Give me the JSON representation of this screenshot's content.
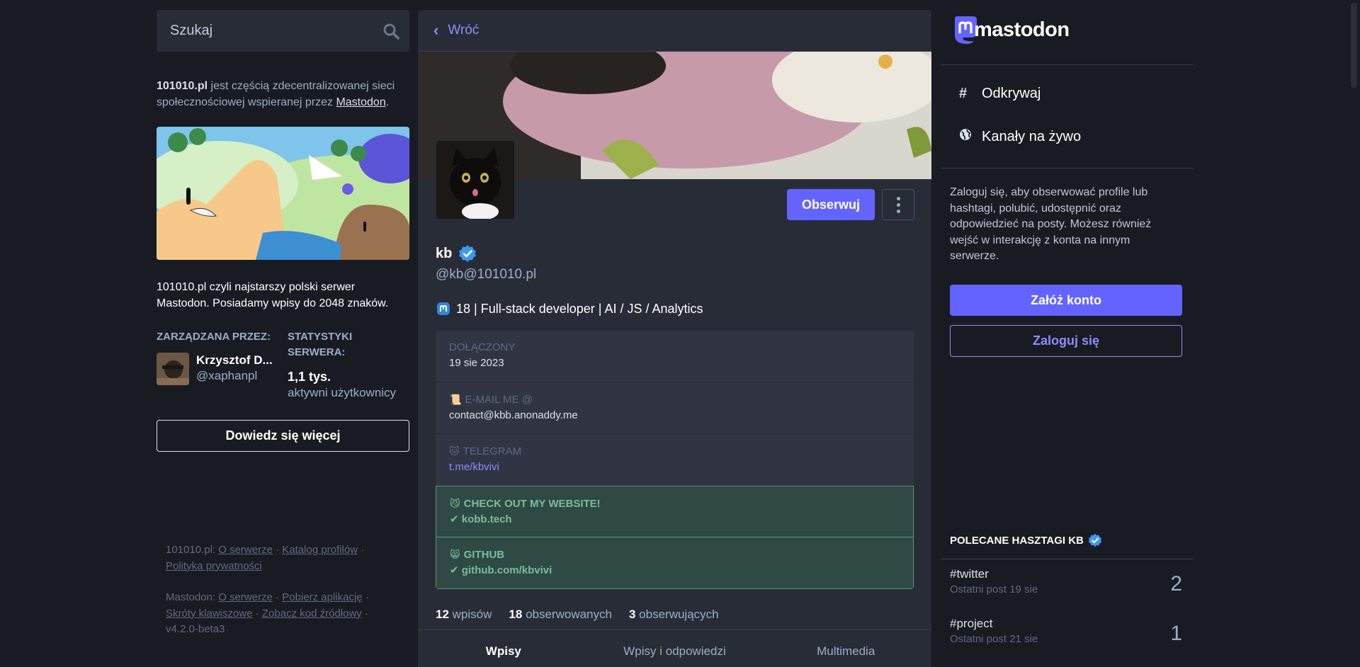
{
  "search": {
    "placeholder": "Szukaj"
  },
  "server_intro": {
    "domain": "101010.pl",
    "text": " jest częścią zdecentralizowanej sieci społecznościowej wspieranej przez ",
    "link": "Mastodon",
    "end": "."
  },
  "server_description": "101010.pl czyli najstarszy polski serwer Mastodon. Posiadamy wpisy do 2048 znaków.",
  "administered_by": {
    "label": "ZARZĄDZANA PRZEZ:",
    "name": "Krzysztof D...",
    "handle": "@xaphanpl"
  },
  "server_stats": {
    "label": "STATYSTYKI SERWERA:",
    "value": "1,1 tys.",
    "unit": "aktywni użytkownicy"
  },
  "learn_more_label": "Dowiedz się więcej",
  "footer": {
    "server_label": "101010.pl:",
    "server_links": [
      "O serwerze",
      "Katalog profilów",
      "Polityka prywatności"
    ],
    "mastodon_label": "Mastodon:",
    "mastodon_links": [
      "O serwerze",
      "Pobierz aplikację",
      "Skróty klawiszowe",
      "Zobacz kod źródłowy"
    ],
    "version": "v4.2.0-beta3",
    "sep": "·"
  },
  "back_label": "Wróć",
  "profile": {
    "display_name": "kb",
    "handle": "@kb@101010.pl",
    "bio": "18 | Full-stack developer | AI / JS / Analytics",
    "follow_label": "Obserwuj",
    "fields": [
      {
        "emoji": "",
        "label": "DOŁĄCZONY",
        "value": "19 sie 2023",
        "verified": false,
        "link": false
      },
      {
        "emoji": "📜",
        "label": "E-MAIL ME @",
        "value": "contact@kbb.anonaddy.me",
        "verified": false,
        "link": false
      },
      {
        "emoji": "🐱",
        "label": "TELEGRAM",
        "value": "t.me/kbvivi",
        "verified": false,
        "link": true
      },
      {
        "emoji": "😼",
        "label": "CHECK OUT MY WEBSITE!",
        "value": "kobb.tech",
        "verified": true,
        "link": true
      },
      {
        "emoji": "😸",
        "label": "GITHUB",
        "value": "github.com/kbvivi",
        "verified": true,
        "link": true
      }
    ],
    "counts": [
      {
        "num": "12",
        "label": "wpisów"
      },
      {
        "num": "18",
        "label": "obserwowanych"
      },
      {
        "num": "3",
        "label": "obserwujących"
      }
    ],
    "tabs": [
      "Wpisy",
      "Wpisy i odpowiedzi",
      "Multimedia"
    ]
  },
  "right": {
    "logo_text": "mastodon",
    "nav": [
      {
        "icon": "#",
        "label": "Odkrywaj"
      },
      {
        "icon": "globe",
        "label": "Kanały na żywo"
      }
    ],
    "login_prompt": "Zaloguj się, aby obserwować profile lub hashtagi, polubić, udostępnić oraz odpowiedzieć na posty. Możesz również wejść w interakcję z konta na innym serwerze.",
    "signup_label": "Załóż konto",
    "login_label": "Zaloguj się",
    "featured_tags_title": "POLECANE HASZTAGI KB",
    "tags": [
      {
        "name": "#twitter",
        "sub": "Ostatni post 19 sie",
        "count": "2"
      },
      {
        "name": "#project",
        "sub": "Ostatni post 21 sie",
        "count": "1"
      }
    ]
  },
  "colors": {
    "accent": "#6364ff",
    "link": "#8c8dff",
    "verified": "#79bd9a",
    "bg": "#191b22",
    "panel": "#282c37"
  }
}
